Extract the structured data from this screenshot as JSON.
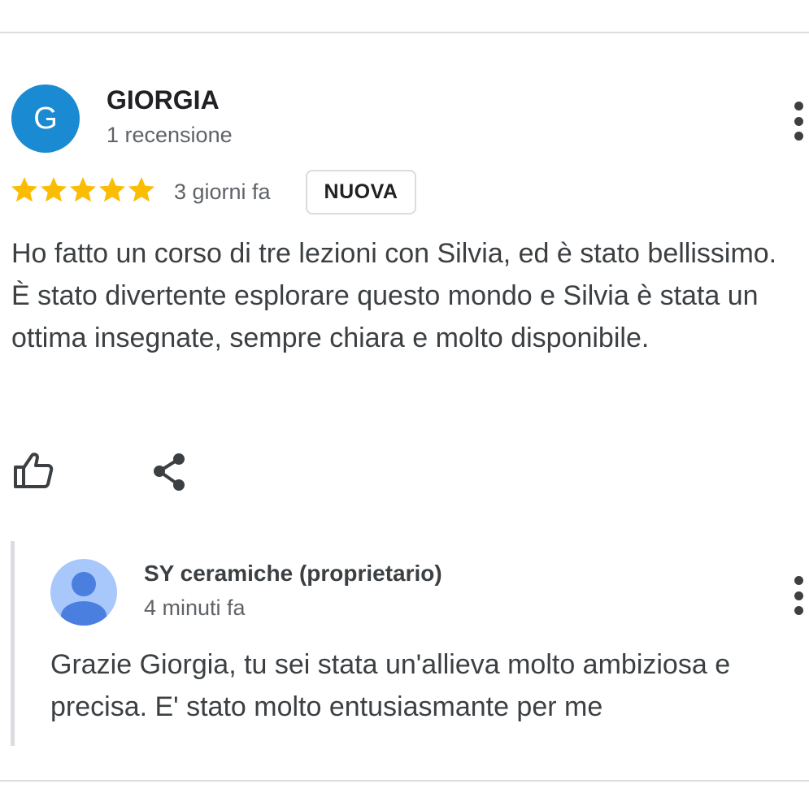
{
  "review": {
    "avatar_initial": "G",
    "avatar_color": "#1a8ad3",
    "reviewer_name": "GIORGIA",
    "reviewer_meta": "1 recensione",
    "rating": 5,
    "rating_max": 5,
    "star_color": "#fbbc04",
    "date": "3 giorni fa",
    "badge": "NUOVA",
    "text": "Ho fatto un corso di tre lezioni con Silvia, ed è stato bellissimo. È stato divertente esplorare questo mondo e Silvia è stata un ottima insegnate, sempre chiara e molto disponibile.",
    "actions": {
      "like_icon": "thumb-up-icon",
      "share_icon": "share-icon",
      "menu_icon": "more-vert-icon"
    }
  },
  "owner_reply": {
    "avatar_icon": "person-icon",
    "avatar_color": "#a8c7fa",
    "name": "SY ceramiche (proprietario)",
    "date": "4 minuti fa",
    "text": "Grazie Giorgia, tu sei stata un'allieva molto ambiziosa e precisa. E' stato molto entusiasmante per me",
    "menu_icon": "more-vert-icon"
  }
}
